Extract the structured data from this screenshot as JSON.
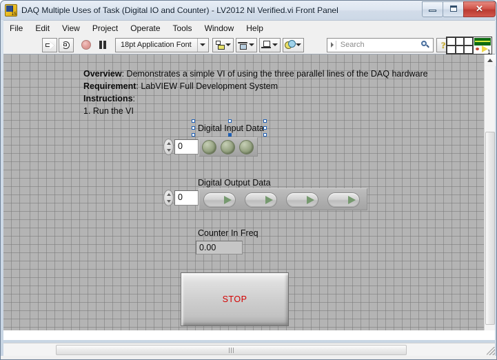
{
  "window": {
    "title": "DAQ Multiple Uses of Task (Digital IO and Counter) - LV2012 NI Verified.vi Front Panel",
    "icon_name": "labview-vi-icon",
    "icon_badge": "15",
    "minimize_label": "–",
    "maximize_label": "□",
    "close_label": "✕"
  },
  "menu": {
    "items": [
      {
        "label": "File"
      },
      {
        "label": "Edit"
      },
      {
        "label": "View"
      },
      {
        "label": "Project"
      },
      {
        "label": "Operate"
      },
      {
        "label": "Tools"
      },
      {
        "label": "Window"
      },
      {
        "label": "Help"
      }
    ]
  },
  "toolbar": {
    "run_icon": "run-arrow-icon",
    "run_continuously_icon": "run-continuously-icon",
    "abort_icon": "abort-execution-icon",
    "pause_icon": "pause-icon",
    "font_label": "18pt Application Font",
    "font_dropdown_icon": "chevron-down-icon",
    "align_objects_icon": "align-objects-icon",
    "distribute_objects_icon": "distribute-objects-icon",
    "resize_objects_icon": "resize-objects-icon",
    "reorder_icon": "reorder-objects-icon",
    "search_placeholder": "Search",
    "search_value": "",
    "search_icon": "magnifier-icon",
    "search_scope_icon": "search-scope-icon",
    "help_icon": "context-help-icon",
    "connector_pane_icon": "connector-pane-icon",
    "vi_icon_number": "1"
  },
  "panel": {
    "description": {
      "overview_label": "Overview",
      "overview_text": ": Demonstrates a simple VI of using the three parallel lines of the DAQ hardware",
      "requirement_label": "Requirement",
      "requirement_text": ": LabVIEW Full Development System",
      "instructions_label": "Instructions",
      "instructions_text": ":",
      "step_1": "1. Run the VI"
    },
    "digital_input": {
      "label": "Digital Input Data",
      "value": "0",
      "selected": true,
      "leds": [
        {
          "name": "led-0",
          "on": false
        },
        {
          "name": "led-1",
          "on": false
        },
        {
          "name": "led-2",
          "on": false
        }
      ]
    },
    "digital_output": {
      "label": "Digital Output Data",
      "value": "0",
      "switches": [
        {
          "name": "switch-0",
          "on": false
        },
        {
          "name": "switch-1",
          "on": false
        },
        {
          "name": "switch-2",
          "on": false
        },
        {
          "name": "switch-3",
          "on": false
        }
      ]
    },
    "counter": {
      "label": "Counter In Freq",
      "value": "0.00"
    },
    "stop_button": {
      "label": "STOP"
    }
  },
  "scrollbars": {
    "v_up_icon": "scroll-up-icon",
    "v_down_icon": "scroll-down-icon",
    "h_left_icon": "scroll-left-icon",
    "h_right_icon": "scroll-right-icon",
    "resize_grip_icon": "resize-grip-icon"
  },
  "colors": {
    "panel_background": "#b4b4b4",
    "stop_text": "#d40000",
    "led_green": "#8c9a78",
    "title_gradient_top": "#e8eef6",
    "close_button": "#cf4a3e"
  }
}
